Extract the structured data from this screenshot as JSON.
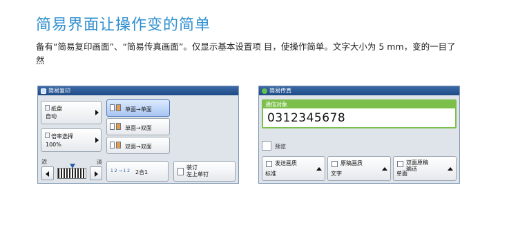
{
  "title": "简易界面让操作变的简单",
  "description": "备有“简易复印画面”、“简易传真画面”。仅显示基本设置项 目，使操作简单。文字大小为 5 mm，变的一目了然",
  "copy_panel": {
    "title": "简易复印",
    "paper": {
      "label": "纸盘",
      "value": "自动"
    },
    "ratio": {
      "label": "倍率选择",
      "value": "100%"
    },
    "duplex_options": [
      "单面→单面",
      "单面→双面",
      "双面→双面"
    ],
    "density": {
      "left": "浓",
      "right": "淡"
    },
    "nup": {
      "label": "2合1",
      "icon": "1 2 → 1 2"
    },
    "staple": {
      "label": "装订\n左上单钉"
    }
  },
  "fax_panel": {
    "title": "简易传真",
    "field_label": "通信对象",
    "field_value": "0312345678",
    "preview_label": "预览",
    "buttons": [
      {
        "label": "发送画质",
        "value": "标准"
      },
      {
        "label": "原稿画质",
        "value": "文字"
      },
      {
        "label": "双面原稿\n输送",
        "value": "单面"
      }
    ]
  },
  "colors": {
    "title": "#2f8fd0",
    "accent_green": "#7cc04b",
    "titlebar": "#1c4a86"
  }
}
